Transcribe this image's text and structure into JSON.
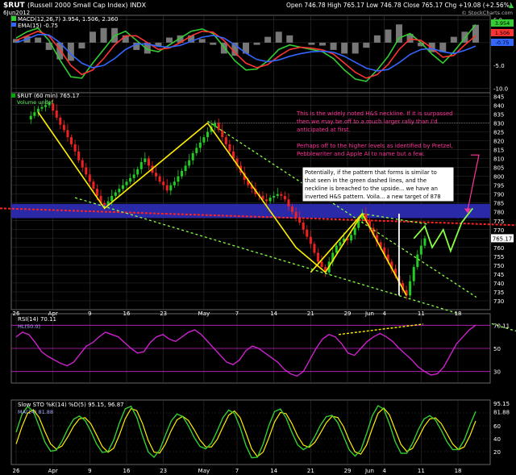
{
  "header": {
    "ticker": "$RUT",
    "name": "(Russell 2000 Small Cap Index) INDX",
    "date": "6Jun2012",
    "quote": "Open 746.78  High 765.17  Low 746.78  Close 765.17  Chg +19.08 (+2.56%)",
    "quote_arrow": "▲",
    "watermark": "© StockCharts.com"
  },
  "chart_data": [
    {
      "type": "histogram+line",
      "panel": "MACD",
      "legend_macd": "MACD(12,26,7) 3.954, 1.506, 2.360",
      "legend_ema": "EMA(15) -0.75",
      "ylim": [
        -11,
        6
      ],
      "y_ticks": [
        "5.0",
        "0.0",
        "-5.0",
        "-10.0"
      ],
      "last_values": {
        "macd": "3.954",
        "signal": "1.506",
        "hist": "2.360",
        "ema": "-0.75"
      },
      "series": [
        {
          "name": "MACD",
          "color": "#33cc33",
          "values": [
            1.0,
            2.4,
            3.2,
            0.5,
            -3.8,
            -7.5,
            -7.8,
            -4.5,
            -1.5,
            1.5,
            2.5,
            0.5,
            -1.5,
            -2.0,
            -0.5,
            1.0,
            2.5,
            3.0,
            2.0,
            -1.0,
            -4.0,
            -6.0,
            -5.8,
            -4.0,
            -1.5,
            -0.5,
            -1.0,
            -1.5,
            -2.0,
            -3.5,
            -6.0,
            -8.0,
            -8.5,
            -6.0,
            -3.0,
            1.0,
            2.0,
            0.0,
            -2.5,
            -4.5,
            -2.0,
            1.0,
            3.954
          ]
        },
        {
          "name": "Signal",
          "color": "#ff3333",
          "values": [
            0.5,
            1.5,
            2.5,
            1.5,
            -1.5,
            -5.0,
            -7.0,
            -6.0,
            -3.5,
            -0.5,
            1.5,
            1.5,
            0.0,
            -1.5,
            -1.2,
            0.0,
            1.5,
            2.5,
            2.3,
            0.5,
            -2.2,
            -4.5,
            -5.5,
            -4.8,
            -3.0,
            -1.5,
            -1.0,
            -1.2,
            -1.6,
            -2.5,
            -4.5,
            -6.5,
            -7.8,
            -7.0,
            -4.8,
            -1.5,
            0.8,
            0.5,
            -1.2,
            -3.2,
            -2.8,
            -0.5,
            1.506
          ]
        },
        {
          "name": "EMA",
          "color": "#3366ff",
          "values": [
            0.0,
            0.8,
            1.8,
            1.7,
            0.0,
            -2.5,
            -4.5,
            -5.5,
            -5.0,
            -3.5,
            -1.5,
            -0.3,
            -0.3,
            -0.8,
            -1.0,
            -0.6,
            0.3,
            1.2,
            1.6,
            1.0,
            -0.5,
            -2.3,
            -3.7,
            -4.2,
            -3.8,
            -3.0,
            -2.4,
            -2.0,
            -1.9,
            -2.1,
            -3.0,
            -4.3,
            -5.6,
            -6.2,
            -5.9,
            -4.4,
            -2.6,
            -1.5,
            -1.3,
            -2.0,
            -2.4,
            -1.7,
            -0.75
          ]
        }
      ]
    },
    {
      "type": "candlestick",
      "panel": "Price",
      "legend_price": "$RUT (60 min) 765.17",
      "legend_volume": "Volume undef",
      "ylim": [
        725,
        847
      ],
      "y_ticks": [
        845,
        840,
        835,
        830,
        825,
        820,
        815,
        810,
        805,
        800,
        795,
        790,
        785,
        780,
        775,
        770,
        765,
        760,
        755,
        750,
        745,
        740,
        735,
        730
      ],
      "last_price": "765.17",
      "x_tick_labels": [
        "26",
        "Apr",
        "9",
        "16",
        "23",
        "May",
        "7",
        "14",
        "21",
        "29",
        "Jun",
        "4",
        "11",
        "18"
      ],
      "x_tick_index": [
        0,
        10,
        20,
        30,
        40,
        51,
        60,
        70,
        80,
        90,
        96,
        100,
        110,
        120
      ],
      "n_slots": 128,
      "close": [
        832,
        834,
        836,
        838,
        839,
        840,
        841,
        837,
        833,
        829,
        826,
        822,
        818,
        814,
        809,
        805,
        801,
        797,
        793,
        789,
        785,
        784,
        786,
        789,
        791,
        793,
        795,
        797,
        799,
        801,
        804,
        808,
        810,
        806,
        802,
        800,
        797,
        795,
        792,
        795,
        797,
        800,
        803,
        806,
        809,
        813,
        816,
        819,
        822,
        825,
        828,
        830,
        826,
        822,
        818,
        814,
        810,
        806,
        802,
        798,
        795,
        793,
        790,
        789,
        787,
        786,
        788,
        789,
        790,
        789,
        787,
        783,
        780,
        777,
        774,
        770,
        766,
        762,
        757,
        752,
        749,
        746,
        752,
        757,
        761,
        763,
        765,
        764,
        767,
        771,
        776,
        779,
        775,
        771,
        767,
        763,
        760,
        756,
        752,
        748,
        744,
        740,
        736,
        733,
        741,
        749,
        756,
        761,
        765.17
      ],
      "annotations": [
        {
          "text_lines": [
            "This is the widely noted H&S neckline.  If it is surpassed",
            "then we may be off to a much larger rally than I'd",
            "anticipated at first."
          ],
          "color": "#ff3399"
        },
        {
          "text_lines": [
            "Perhaps off to the higher levels as identified by Pretzel,",
            "Pebblewriter and Apple AI to name but a few."
          ],
          "color": "#ff3399"
        },
        {
          "text_lines": [
            "Potentially, if the pattern that forms is similar to",
            "that seen in the green dashed lines, and the",
            "neckline is breached to the upside... we have an",
            "inverted H&S pattern.  Voila... a new target of 878"
          ],
          "color": "#000000"
        }
      ]
    },
    {
      "type": "line",
      "panel": "RSI",
      "legend": "RSI(14) 70.11",
      "legend_hl": "HL(50.0)",
      "ylim": [
        20,
        80
      ],
      "y_ticks": [
        "70.11",
        "50",
        "30"
      ],
      "last_value": "70.11",
      "values": [
        60,
        64,
        62,
        55,
        47,
        43,
        40,
        37,
        35,
        38,
        45,
        52,
        55,
        60,
        64,
        62,
        60,
        55,
        50,
        46,
        47,
        55,
        60,
        62,
        58,
        56,
        60,
        64,
        66,
        62,
        56,
        50,
        44,
        38,
        36,
        40,
        48,
        52,
        50,
        46,
        42,
        38,
        32,
        28,
        26,
        30,
        40,
        50,
        58,
        62,
        60,
        54,
        46,
        44,
        50,
        56,
        60,
        63,
        60,
        56,
        50,
        45,
        40,
        34,
        30,
        27,
        28,
        34,
        44,
        54,
        60,
        66,
        70.11
      ]
    },
    {
      "type": "line",
      "panel": "Slow Stochastic",
      "legend": "Slow STO %K(14) %D(5) 95.15, 96.87",
      "legend_ma": "MA(14) 81.88",
      "ylim": [
        0,
        100
      ],
      "y_ticks": [
        "95.15",
        "81.88",
        "60",
        "40",
        "20"
      ],
      "last_values": {
        "k": "95.15",
        "d": "96.87",
        "ma": "81.88"
      }
    }
  ],
  "colors": {
    "background": "#000000",
    "panel_grid": "#333333",
    "price_up": "#22cc22",
    "price_down": "#ee2222",
    "trendline": "#ffee00",
    "neckline": "#ff2222",
    "channel": "#88ff44",
    "band": "#2a2aa8",
    "rsi": "#cc22cc"
  }
}
